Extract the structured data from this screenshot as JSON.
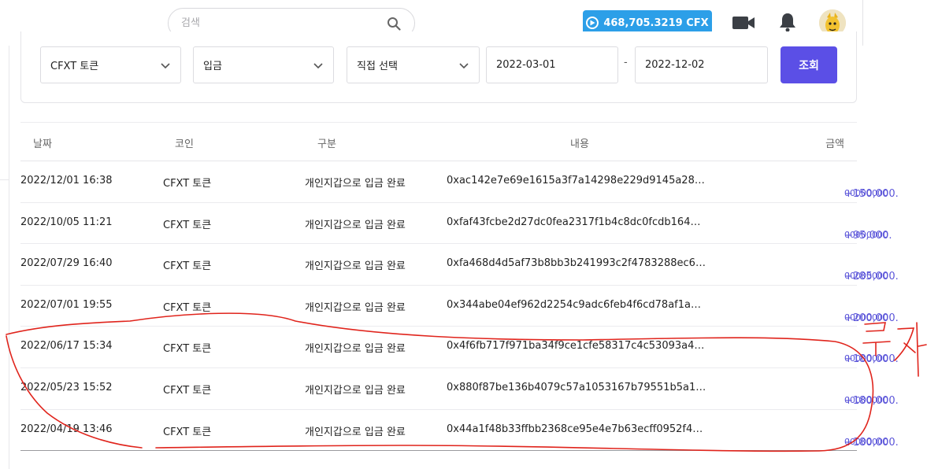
{
  "header": {
    "search_placeholder": "검색",
    "balance": "468,705.3219 CFX",
    "brand_color": "#2c9fe8"
  },
  "filters": {
    "coin": "CFXT 토큰",
    "kind": "입금",
    "period": "직접 선택",
    "start_date": "2022-03-01",
    "separator": "-",
    "end_date": "2022-12-02",
    "query_label": "조회",
    "accent_color": "#5b4fe6"
  },
  "table": {
    "columns": [
      "날짜",
      "코인",
      "구분",
      "내용",
      "금액"
    ],
    "rows": [
      {
        "date": "2022/12/01 16:38",
        "coin": "CFXT 토큰",
        "type": "개인지갑으로 입금 완료",
        "memo": "0xac142e7e69e1615a3f7a14298e229d9145a289...",
        "amount": "+150,000.",
        "decimals": "00000000"
      },
      {
        "date": "2022/10/05 11:21",
        "coin": "CFXT 토큰",
        "type": "개인지갑으로 입금 완료",
        "memo": "0xfaf43fcbe2d27dc0fea2317f1b4c8dc0fcdb1640...",
        "amount": "+95,000.",
        "decimals": "00000000"
      },
      {
        "date": "2022/07/29 16:40",
        "coin": "CFXT 토큰",
        "type": "개인지갑으로 입금 완료",
        "memo": "0xfa468d4d5af73b8bb3b241993c2f4783288ec69...",
        "amount": "+285,000.",
        "decimals": "00000000"
      },
      {
        "date": "2022/07/01 19:55",
        "coin": "CFXT 토큰",
        "type": "개인지갑으로 입금 완료",
        "memo": "0x344abe04ef962d2254c9adc6feb4f6cd78af1a2...",
        "amount": "+200,000.",
        "decimals": "00000000"
      },
      {
        "date": "2022/06/17 15:34",
        "coin": "CFXT 토큰",
        "type": "개인지갑으로 입금 완료",
        "memo": "0x4f6fb717f971ba34f9ce1cfe58317c4c53093a49...",
        "amount": "+180,000.",
        "decimals": "00000000"
      },
      {
        "date": "2022/05/23 15:52",
        "coin": "CFXT 토큰",
        "type": "개인지갑으로 입금 완료",
        "memo": "0x880f87be136b4079c57a1053167b79551b5a1a...",
        "amount": "+180,000.",
        "decimals": "00000000"
      },
      {
        "date": "2022/04/19 13:46",
        "coin": "CFXT 토큰",
        "type": "개인지갑으로 입금 완료",
        "memo": "0x44a1f48b33ffbb2368ce95e4e7b63ecff0952f49...",
        "amount": "+180,000.",
        "decimals": "00000000"
      }
    ],
    "amount_color": "#5b55d9"
  },
  "annotation": {
    "handwritten_text": "투자",
    "ink_color": "#e0241c"
  }
}
